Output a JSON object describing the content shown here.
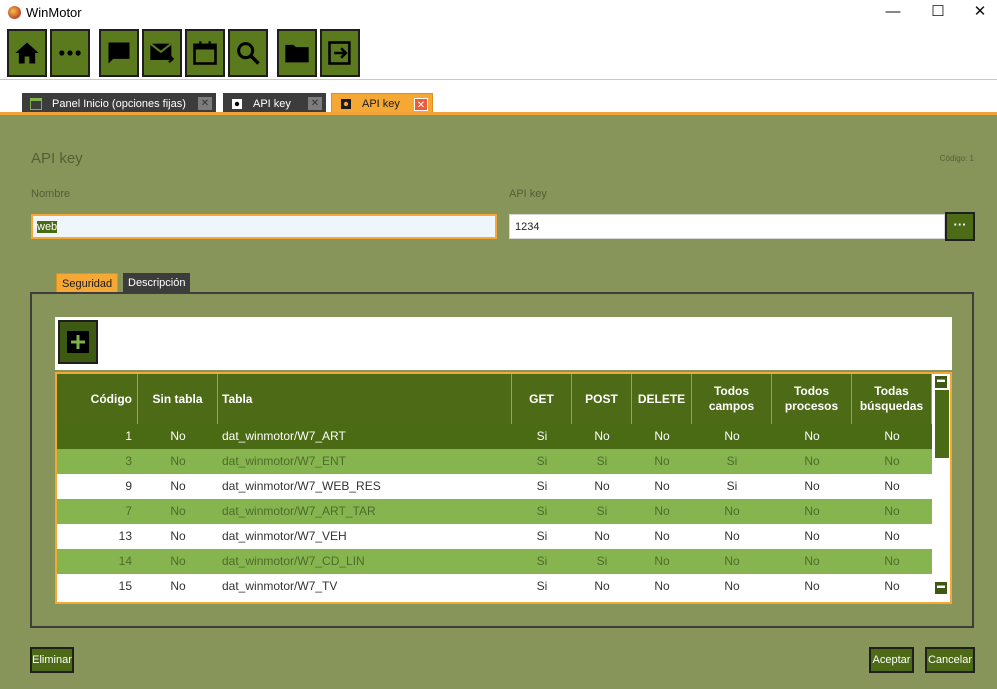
{
  "window": {
    "title": "WinMotor",
    "minimize": "—",
    "maximize": "☐",
    "close": "✕"
  },
  "toolbar": {
    "buttons": [
      {
        "icon": "home-icon"
      },
      {
        "icon": "more-icon"
      },
      {
        "icon": "chat-icon"
      },
      {
        "icon": "mail-forward-icon"
      },
      {
        "icon": "calendar-icon"
      },
      {
        "icon": "search-icon"
      },
      {
        "icon": "folder-icon"
      },
      {
        "icon": "exit-icon"
      }
    ]
  },
  "tabs": [
    {
      "label": "Panel Inicio (opciones fijas)",
      "icon": "panel-icon",
      "close": "✕"
    },
    {
      "label": "API key",
      "icon": "gear-icon",
      "close": "✕"
    },
    {
      "label": "API key",
      "icon": "gear-icon",
      "close": "✕",
      "active": true
    }
  ],
  "form": {
    "title": "API key",
    "codigo": "Código: 1",
    "nombre_label": "Nombre",
    "nombre_value": "web",
    "apikey_label": "API key",
    "apikey_value": "1234",
    "apikey_button": "···"
  },
  "inner_tabs": {
    "seguridad": "Seguridad",
    "descripcion": "Descripción"
  },
  "table": {
    "add_button": "+",
    "headers": [
      "Código",
      "Sin tabla",
      "Tabla",
      "GET",
      "POST",
      "DELETE",
      "Todos campos",
      "Todos procesos",
      "Todas búsquedas"
    ],
    "rows": [
      [
        "1",
        "No",
        "dat_winmotor/W7_ART",
        "Si",
        "No",
        "No",
        "No",
        "No",
        "No"
      ],
      [
        "3",
        "No",
        "dat_winmotor/W7_ENT",
        "Si",
        "Si",
        "No",
        "Si",
        "No",
        "No"
      ],
      [
        "9",
        "No",
        "dat_winmotor/W7_WEB_RES",
        "Si",
        "No",
        "No",
        "Si",
        "No",
        "No"
      ],
      [
        "7",
        "No",
        "dat_winmotor/W7_ART_TAR",
        "Si",
        "Si",
        "No",
        "No",
        "No",
        "No"
      ],
      [
        "13",
        "No",
        "dat_winmotor/W7_VEH",
        "Si",
        "No",
        "No",
        "No",
        "No",
        "No"
      ],
      [
        "14",
        "No",
        "dat_winmotor/W7_CD_LIN",
        "Si",
        "Si",
        "No",
        "No",
        "No",
        "No"
      ],
      [
        "15",
        "No",
        "dat_winmotor/W7_TV",
        "Si",
        "No",
        "No",
        "No",
        "No",
        "No"
      ]
    ],
    "scroll_up": "▬",
    "scroll_down": "▬"
  },
  "footer": {
    "eliminar": "Eliminar",
    "aceptar": "Aceptar",
    "cancelar": "Cancelar"
  },
  "colors": {
    "accent": "#f5a834",
    "primary": "#4d6b17",
    "background": "#87955a",
    "row_alt": "#86b550"
  }
}
